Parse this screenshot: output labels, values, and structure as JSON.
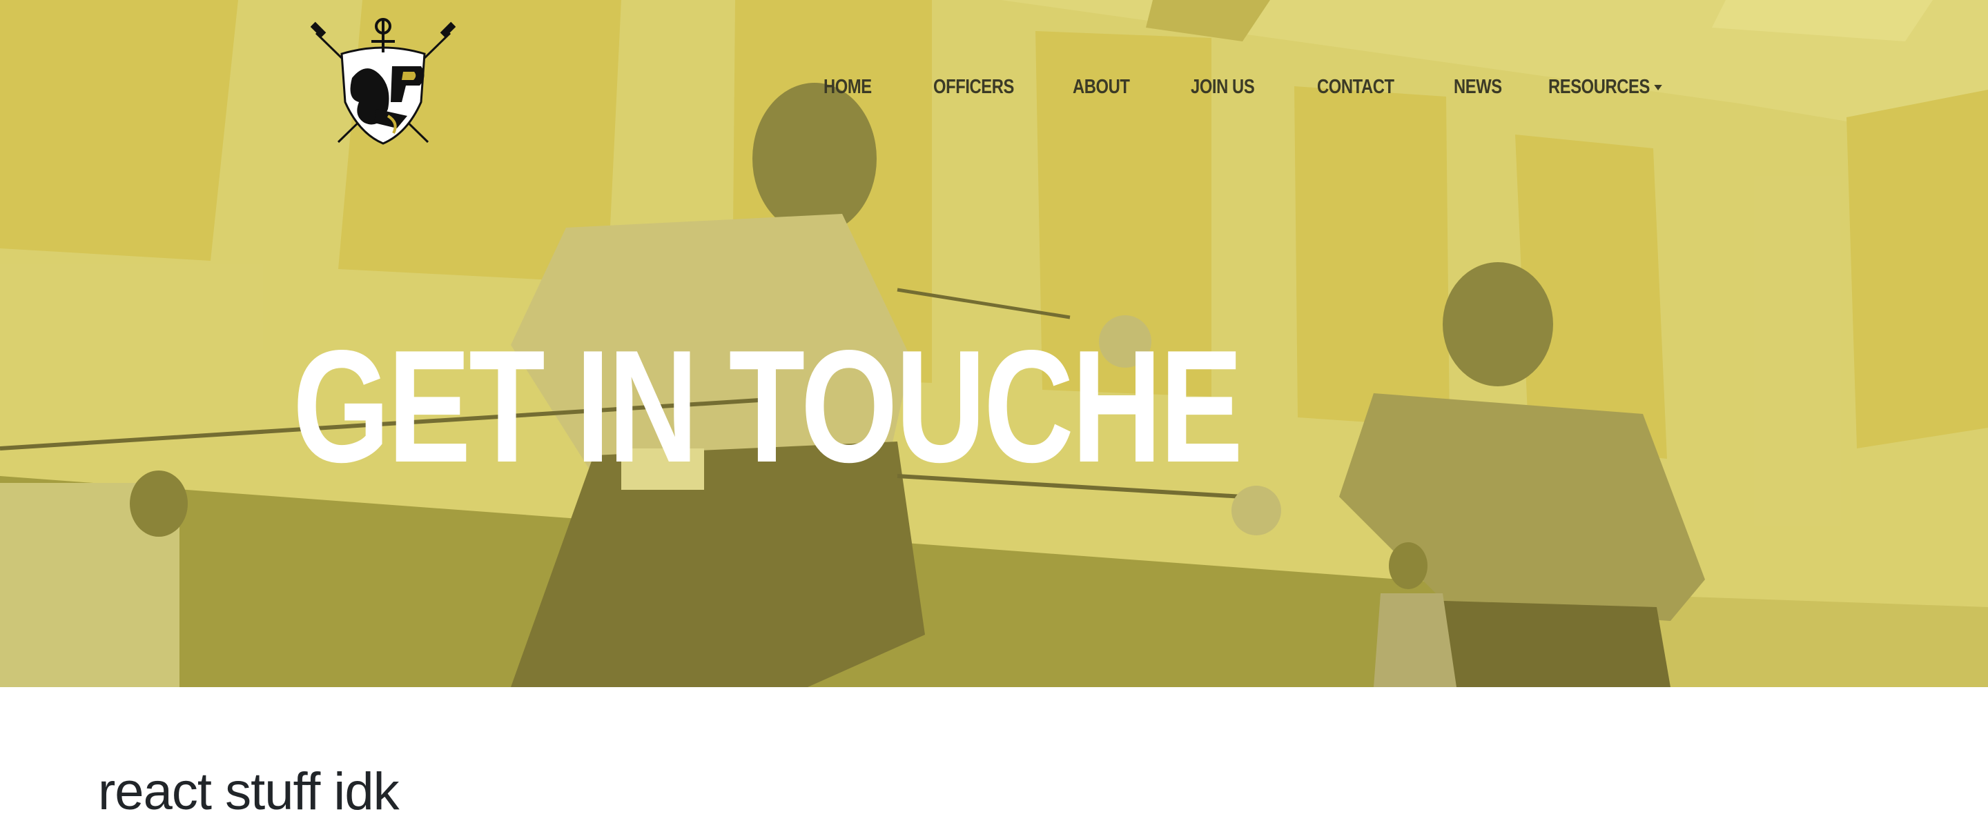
{
  "nav": {
    "items": [
      {
        "label": "HOME"
      },
      {
        "label": "OFFICERS"
      },
      {
        "label": "ABOUT"
      },
      {
        "label": "JOIN US"
      },
      {
        "label": "CONTACT"
      },
      {
        "label": "NEWS"
      },
      {
        "label": "RESOURCES"
      }
    ]
  },
  "hero": {
    "title": "GET IN TOUCHE",
    "overlay_color": "#d6c950"
  },
  "logo": {
    "icon": "fencing-club-crest-icon"
  },
  "content": {
    "heading": "react stuff idk"
  },
  "colors": {
    "nav_text": "#3b3a26",
    "hero_title": "#ffffff",
    "content_text": "#212529"
  }
}
